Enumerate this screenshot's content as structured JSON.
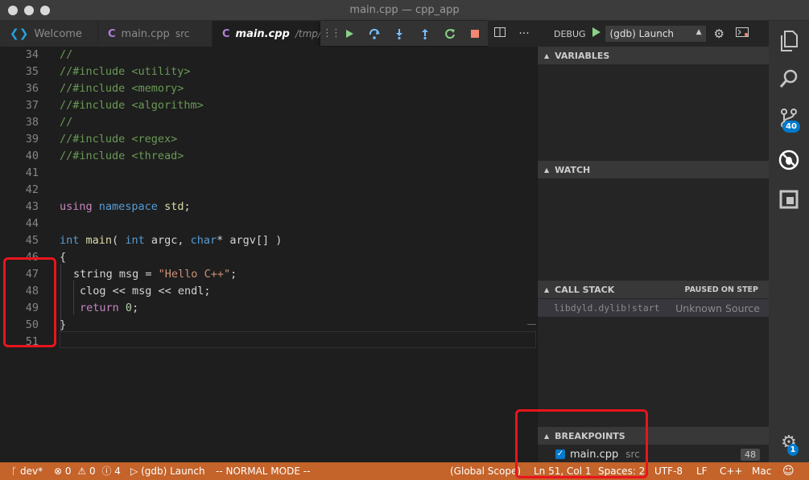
{
  "window": {
    "title": "main.cpp — cpp_app"
  },
  "tabs": [
    {
      "name": "Welcome",
      "sub": ""
    },
    {
      "name": "main.cpp",
      "sub": "src"
    },
    {
      "name": "main.cpp",
      "sub": "/tmp/cp"
    }
  ],
  "debug_header": {
    "label": "DEBUG",
    "config": "(gdb) Launch"
  },
  "editor": {
    "lines": [
      {
        "n": "34",
        "text": "//"
      },
      {
        "n": "35",
        "text": "//#include <utility>"
      },
      {
        "n": "36",
        "text": "//#include <memory>"
      },
      {
        "n": "37",
        "text": "//#include <algorithm>"
      },
      {
        "n": "38",
        "text": "//"
      },
      {
        "n": "39",
        "text": "//#include <regex>"
      },
      {
        "n": "40",
        "text": "//#include <thread>"
      },
      {
        "n": "41",
        "text": ""
      },
      {
        "n": "42",
        "text": ""
      },
      {
        "n": "43",
        "text": "using namespace std;"
      },
      {
        "n": "44",
        "text": ""
      },
      {
        "n": "45",
        "text": "int main( int argc, char* argv[] )"
      },
      {
        "n": "46",
        "text": "{"
      },
      {
        "n": "47",
        "text": "string msg = \"Hello C++\";"
      },
      {
        "n": "48",
        "text": "clog << msg << endl;"
      },
      {
        "n": "49",
        "text": "return 0;"
      },
      {
        "n": "50",
        "text": "}"
      },
      {
        "n": "51",
        "text": ""
      }
    ]
  },
  "panel": {
    "variables": "VARIABLES",
    "watch": "WATCH",
    "call_stack": "CALL STACK",
    "call_stack_state": "PAUSED ON STEP",
    "stack_frame": "libdyld.dylib!start",
    "stack_source": "Unknown Source",
    "breakpoints": "BREAKPOINTS",
    "breakpoint": {
      "file": "main.cpp",
      "dir": "src",
      "line": "48"
    }
  },
  "activity": {
    "scm_badge": "40",
    "settings_badge": "1"
  },
  "statusbar": {
    "branch": "dev*",
    "errors": "0",
    "warnings": "0",
    "info": "4",
    "launch": "(gdb) Launch",
    "mode": "-- NORMAL MODE --",
    "scope": "(Global Scope)",
    "position": "Ln 51, Col 1",
    "spaces": "Spaces: 2",
    "encoding": "UTF-8",
    "eol": "LF",
    "language": "C++",
    "platform": "Mac"
  },
  "colors": {
    "statusbar": "#c4632a",
    "accent": "#007acc",
    "annotation": "#e8151d"
  }
}
